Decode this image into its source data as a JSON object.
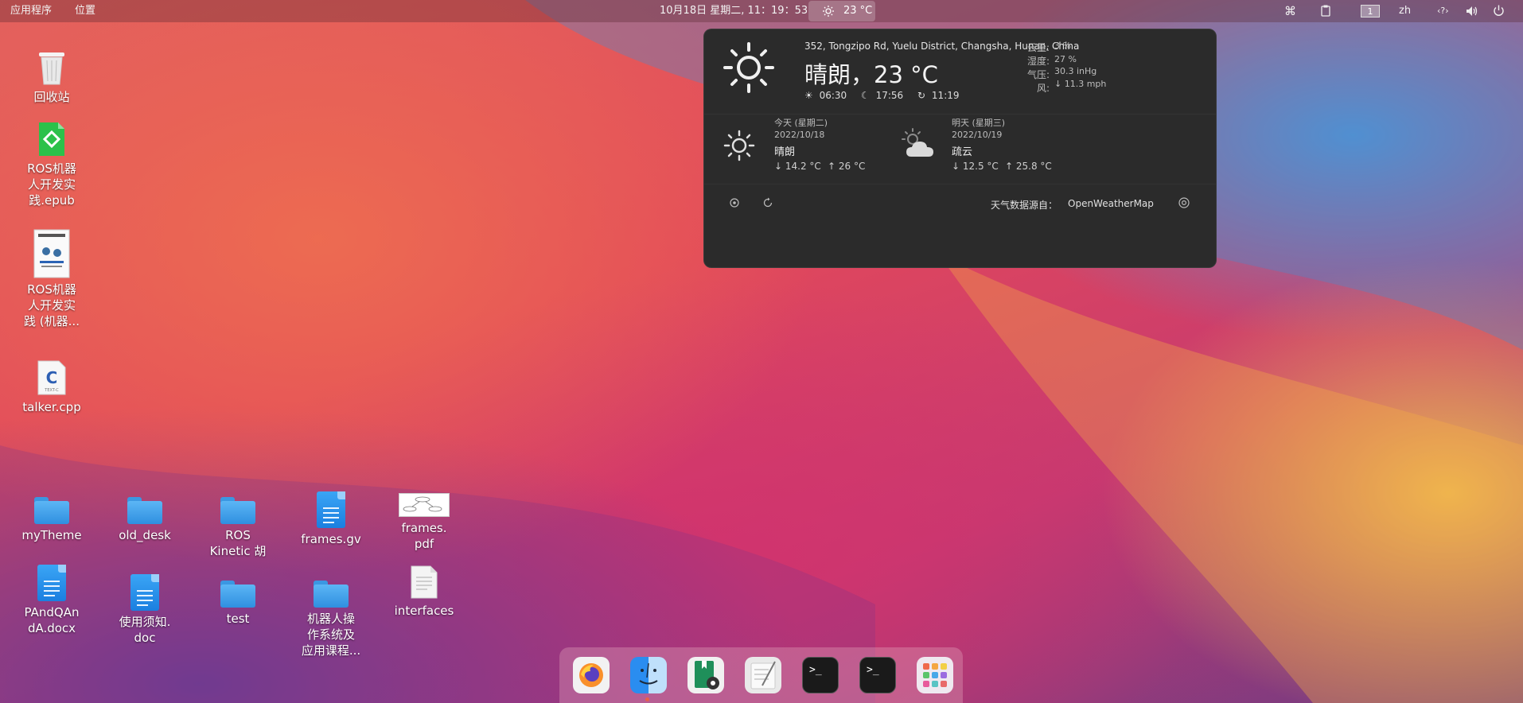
{
  "topbar": {
    "applications": "应用程序",
    "places": "位置",
    "clock": "10月18日 星期二, 11：19：53",
    "weather_temp": "23 °C",
    "workspace": "1",
    "lang": "zh",
    "network_label": "‹?›"
  },
  "weather_popup": {
    "location": "352, Tongzipo Rd, Yuelu District, Changsha, Hunan, China",
    "condition_temp": "晴朗，23 °C",
    "sunrise": "06:30",
    "sunset": "17:56",
    "updated": "11:19",
    "details": [
      {
        "label": "云量:",
        "value": "3 %"
      },
      {
        "label": "湿度:",
        "value": "27 %"
      },
      {
        "label": "气压:",
        "value": "30.3 inHg"
      },
      {
        "label": "风:",
        "value": "↓ 11.3 mph"
      }
    ],
    "forecast": [
      {
        "day": "今天 (星期二)",
        "date": "2022/10/18",
        "condition": "晴朗",
        "low": "↓ 14.2 °C",
        "high": "↑ 26 °C",
        "icon": "sun-icon"
      },
      {
        "day": "明天 (星期三)",
        "date": "2022/10/19",
        "condition": "疏云",
        "low": "↓ 12.5 °C",
        "high": "↑ 25.8 °C",
        "icon": "partly-cloudy-icon"
      }
    ],
    "source_label": "天气数据源自：",
    "source_name": "OpenWeatherMap"
  },
  "desktop_icons": [
    {
      "label": "回收站",
      "icon": "trash-icon"
    },
    {
      "label": "ROS机器\n人开发实\n践.epub",
      "icon": "epub-icon"
    },
    {
      "label": "ROS机器\n人开发实\n践 (机器...",
      "icon": "pdf-book-icon"
    },
    {
      "label": "talker.cpp",
      "icon": "cpp-file-icon"
    },
    {
      "label": "myTheme",
      "icon": "folder-icon"
    },
    {
      "label": "old_desk",
      "icon": "folder-icon"
    },
    {
      "label": "ROS\nKinetic 胡",
      "icon": "folder-icon"
    },
    {
      "label": "frames.gv",
      "icon": "document-icon"
    },
    {
      "label": "frames.\npdf",
      "icon": "pdf-thumb-icon"
    },
    {
      "label": "PAndQAn\ndA.docx",
      "icon": "document-icon"
    },
    {
      "label": "使用须知.\ndoc",
      "icon": "document-icon"
    },
    {
      "label": "test",
      "icon": "folder-icon"
    },
    {
      "label": "机器人操\n作系统及\n应用课程...",
      "icon": "folder-icon"
    },
    {
      "label": "interfaces",
      "icon": "text-file-icon"
    }
  ],
  "dock": [
    {
      "name": "firefox-icon"
    },
    {
      "name": "finder-icon"
    },
    {
      "name": "document-viewer-icon"
    },
    {
      "name": "text-editor-icon"
    },
    {
      "name": "terminal-icon"
    },
    {
      "name": "terminal-icon"
    },
    {
      "name": "app-grid-icon"
    }
  ],
  "colors": {
    "popup_bg": "#2b2b2b",
    "folder_blue": "#3b97e2",
    "running_dot": "#e8604a"
  }
}
